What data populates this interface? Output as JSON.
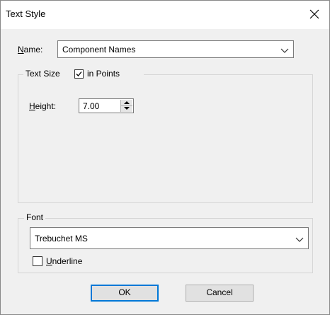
{
  "window": {
    "title": "Text Style"
  },
  "name_field": {
    "label_underlined": "N",
    "label_rest": "ame:",
    "value": "Component Names"
  },
  "text_size_group": {
    "legend_text": "Text Size",
    "in_points_label": "in Points",
    "in_points_checked": true,
    "height_label_underlined": "H",
    "height_label_rest": "eight:",
    "height_value": "7.00"
  },
  "font_group": {
    "legend_text": "Font",
    "font_value": "Trebuchet MS",
    "underline_label_underlined": "U",
    "underline_label_rest": "nderline",
    "underline_checked": false
  },
  "buttons": {
    "ok_label": "OK",
    "cancel_label": "Cancel"
  }
}
